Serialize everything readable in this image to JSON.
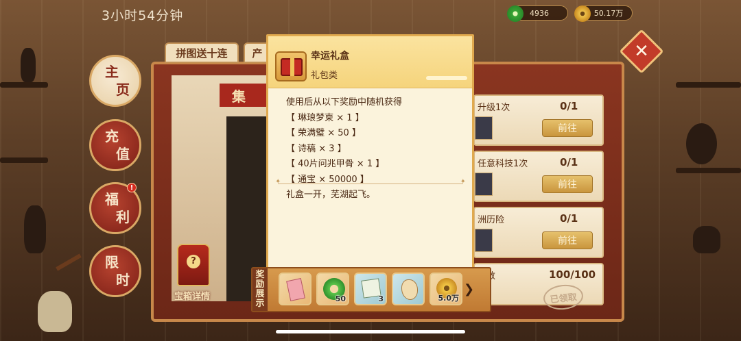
{
  "status_bar": {
    "timer": "3小时54分钟",
    "jade_amount": "4936",
    "coin_amount": "50.17万"
  },
  "nav": {
    "home": [
      "主",
      "页"
    ],
    "recharge": [
      "充",
      "值"
    ],
    "welfare": [
      "福",
      "利"
    ],
    "limited": [
      "限",
      "时"
    ],
    "welfare_badge": "!"
  },
  "tabs": {
    "puzzle_tab": "拼图送十连",
    "tab2_partial": "产"
  },
  "banner_partial": "集",
  "tasks": [
    {
      "title": "升级1次",
      "count": "0/1",
      "button": "前往"
    },
    {
      "title": "任意科技1次",
      "count": "0/1",
      "button": "前往"
    },
    {
      "title": "洲历险",
      "count": "0/1",
      "button": "前往"
    },
    {
      "title": "料数",
      "count": "100/100",
      "button": "已领取"
    }
  ],
  "treasure": {
    "label": "宝箱详情",
    "icon": "?"
  },
  "popup": {
    "title": "幸运礼盒",
    "type": "礼包类",
    "description": [
      "使用后从以下奖励中随机获得",
      "【 琳琅梦柬 × 1 】",
      "【 荣满璧 × 50 】",
      "【 诗稿 × 3 】",
      "【 40片问兆甲骨 × 1 】",
      "【 通宝 × 50000 】"
    ],
    "flavor": "礼盒一开，芜湖起飞。"
  },
  "rewards": {
    "label": [
      "奖",
      "励",
      "展",
      "示"
    ],
    "items": [
      {
        "icon": "invitation-card-icon",
        "count": ""
      },
      {
        "icon": "jade-disc-icon",
        "count": "50"
      },
      {
        "icon": "manuscript-icon",
        "count": "3"
      },
      {
        "icon": "oracle-bone-icon",
        "count": ""
      },
      {
        "icon": "copper-coin-icon",
        "count": "5.0万"
      }
    ],
    "more_arrow": "❯"
  },
  "close": "✕"
}
